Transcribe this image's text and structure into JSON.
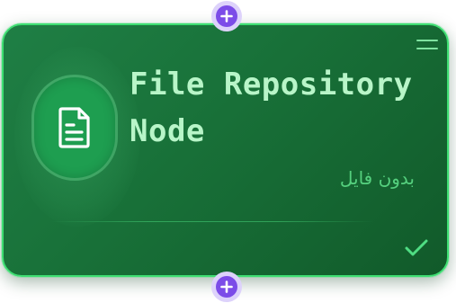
{
  "node": {
    "title": "File Repository Node",
    "subtitle": "بدون فايل",
    "icon": "document-icon",
    "menu_icon": "menu-lines-icon",
    "status_icon": "check-icon"
  },
  "ports": {
    "top": {
      "icon": "plus-icon"
    },
    "bottom": {
      "icon": "plus-icon"
    }
  },
  "colors": {
    "card_background": "#187038",
    "card_border": "#3ede72",
    "title": "#b8f5c8",
    "subtitle": "#55d07e",
    "icon_badge": "#1e9e50",
    "port_fill": "#7c4ce8",
    "port_ring": "#ddd2fb",
    "check": "#4fdd83"
  }
}
